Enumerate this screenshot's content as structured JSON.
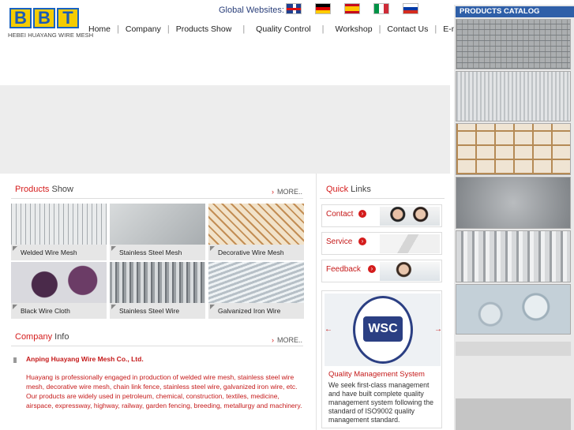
{
  "header": {
    "logo_letters": [
      "B",
      "B",
      "T"
    ],
    "logo_text": "HEBEI  HUAYANG WIRE MESH",
    "global_label": "Global Websites:",
    "flags": [
      "uk-flag-icon",
      "germany-flag-icon",
      "spain-flag-icon",
      "italy-flag-icon",
      "russia-flag-icon"
    ]
  },
  "nav": {
    "items": [
      "Home",
      "Company",
      "Products Show",
      "Quality Control",
      "Workshop",
      "Contact Us",
      "E-mail"
    ],
    "separator": "|"
  },
  "catalog": {
    "title": "PRODUCTS CATALOG"
  },
  "products": {
    "title_red": "Products",
    "title_rest": " Show",
    "more": "MORE..",
    "items": [
      "Welded Wire Mesh",
      "Stainless Steel Mesh",
      "Decorative Wire Mesh",
      "Black Wire Cloth",
      "Stainless Steel Wire",
      "Galvanized Iron Wire"
    ]
  },
  "company": {
    "title_red": "Company",
    "title_rest": " Info",
    "more": "MORE..",
    "name": "Anping Huayang Wire Mesh Co., Ltd.",
    "description": "Huayang is professionally engaged in production of welded wire mesh, stainless steel wire mesh, decorative wire mesh, chain link fence, stainless steel wire, galvanized iron wire, etc. Our products are widely used in petroleum, chemical, construction, textiles, medicine, airspace, expressway, highway, railway, garden fencing, breeding, metallurgy and machinery."
  },
  "quick_links": {
    "title_red": "Quick",
    "title_rest": " Links",
    "items": [
      "Contact",
      "Service",
      "Feedback"
    ]
  },
  "qms": {
    "logo_text": "WSC",
    "title": "Quality Management System",
    "text": "We seek first-class management and have built complete quality management system following the standard of ISO9002 quality management standard."
  },
  "colors": {
    "accent_red": "#d51d1d",
    "catalog_blue": "#2f5fa8",
    "logo_yellow": "#f4cc00"
  }
}
